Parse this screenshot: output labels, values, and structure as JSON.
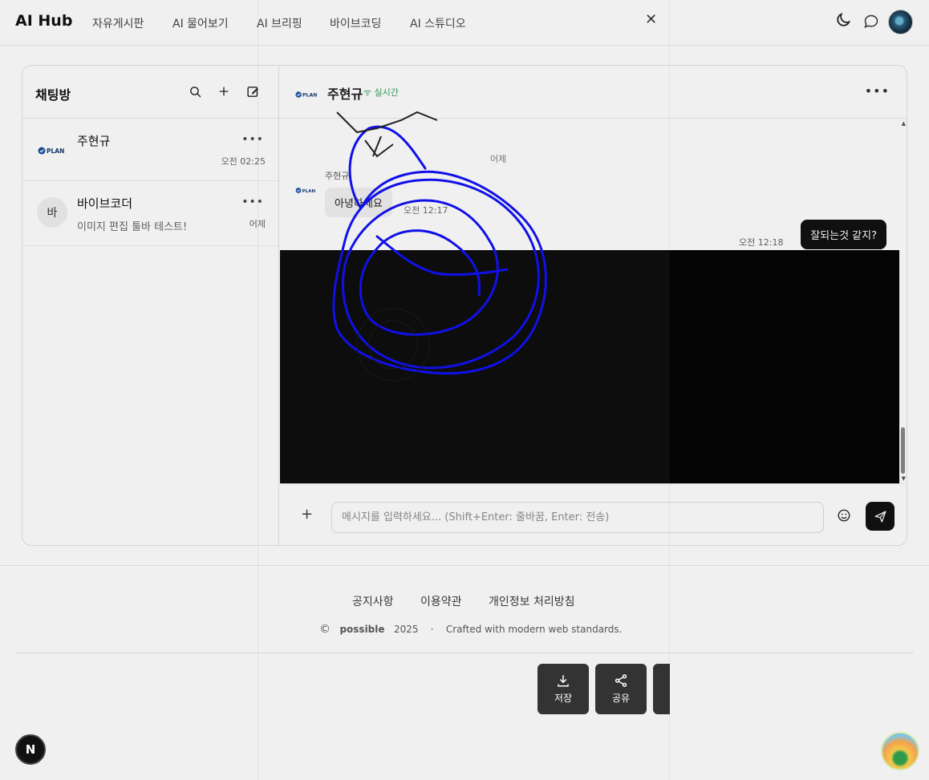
{
  "nav": {
    "brand": "AI Hub",
    "links": [
      "자유게시판",
      "AI 물어보기",
      "AI 브리핑",
      "바이브코딩",
      "AI 스튜디오"
    ],
    "icons": [
      "moon-icon",
      "chat-bubble-icon",
      "avatar"
    ]
  },
  "sidebar": {
    "title": "채팅방",
    "rooms": [
      {
        "name": "주현규",
        "last": "",
        "time": "오전 02:25",
        "logo": "PLAN"
      },
      {
        "name": "바이브코더",
        "last": "이미지 편집 툴바 테스트!",
        "time": "어제",
        "initial": "바"
      }
    ]
  },
  "chat": {
    "logo": "PLAN",
    "name": "주현규",
    "status": "실시간",
    "day_separator": "어제",
    "sender": "주현규",
    "incoming": {
      "text": "아녕하세요",
      "time": "오전 12:17"
    },
    "outgoing": {
      "text": "잘되는것 같지?",
      "time": "오전 12:18"
    },
    "input_placeholder": "메시지를 입력하세요... (Shift+Enter: 줄바꿈, Enter: 전송)"
  },
  "footer": {
    "links": [
      "공지사항",
      "이용약관",
      "개인정보 처리방침"
    ],
    "copyright_symbol": "©",
    "company": "possible",
    "year": "2025",
    "dot": "·",
    "tagline": "Crafted with modern web standards."
  },
  "editor_toolbar": {
    "save": "저장",
    "share": "공유"
  },
  "badge": "N",
  "colors": {
    "accent_live": "#2c9f56",
    "drawing_stroke": "#1010e8",
    "dark_button": "#111111"
  }
}
